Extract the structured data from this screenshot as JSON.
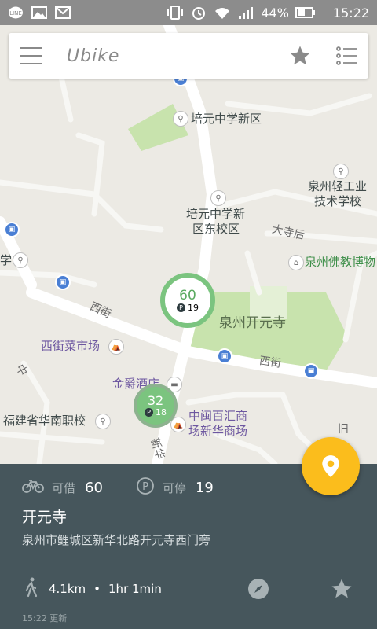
{
  "status_bar": {
    "battery": "44%",
    "time": "15:22",
    "left_icons": [
      "line-app-icon",
      "image-icon",
      "mail-icon"
    ],
    "right_icons": [
      "vibrate-icon",
      "alarm-icon",
      "wifi-icon",
      "signal-icon",
      "battery-icon"
    ]
  },
  "toolbar": {
    "logo_text": "Ubike",
    "icons": [
      "hamburger-menu-icon",
      "star-icon",
      "list-icon"
    ]
  },
  "map": {
    "labels": {
      "peiyuan_new": "培元中学新区",
      "peiyuan_east_1": "培元中学新",
      "peiyuan_east_2": "区东校区",
      "qinggong_1": "泉州轻工业",
      "qinggong_2": "技术学校",
      "dasi": "大寺后",
      "museum": "泉州佛教博物",
      "school_left": "学",
      "kaiyuan_park": "泉州开元寺",
      "xijie_left": "西街",
      "xijie_right": "西街",
      "market": "西街菜市场",
      "jinjue": "金爵酒店",
      "zhongmin_1": "中闽百汇商",
      "zhongmin_2": "场新华商场",
      "huanan": "福建省华南职校",
      "jiu": "旧",
      "xinhua": "新华",
      "zhongqu": "中"
    },
    "stations": [
      {
        "bikes": "60",
        "parking": "19"
      },
      {
        "bikes": "32",
        "parking": "18"
      }
    ],
    "colors": {
      "land": "#eceae4",
      "park": "#c8e3ad",
      "road": "#ffffff",
      "marker": "#7bc47f",
      "fab": "#fbbd1c"
    }
  },
  "panel": {
    "borrow_label": "可借",
    "borrow_value": "60",
    "park_label": "可停",
    "park_value": "19",
    "station_name": "开元寺",
    "address": "泉州市鲤城区新华北路开元寺西门旁",
    "distance": "4.1km",
    "separator": "•",
    "walk_time": "1hr 1min",
    "updated": "15:22 更新",
    "colors": {
      "panel_bg": "#46565c"
    }
  }
}
